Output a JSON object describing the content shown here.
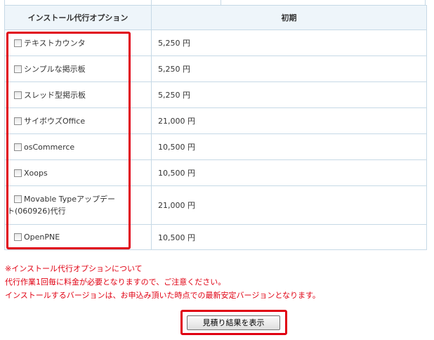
{
  "table": {
    "headers": {
      "option": "インストール代行オプション",
      "initial": "初期"
    },
    "rows": [
      {
        "label": "テキストカウンタ",
        "price": "5,250 円",
        "checked": false
      },
      {
        "label": "シンプルな掲示板",
        "price": "5,250 円",
        "checked": false
      },
      {
        "label": "スレッド型掲示板",
        "price": "5,250 円",
        "checked": false
      },
      {
        "label": "サイボウズOffice",
        "price": "21,000 円",
        "checked": false
      },
      {
        "label": "osCommerce",
        "price": "10,500 円",
        "checked": false
      },
      {
        "label": "Xoops",
        "price": "10,500 円",
        "checked": false
      },
      {
        "label": "Movable Typeアップデート(060926)代行",
        "price": "21,000 円",
        "checked": false
      },
      {
        "label": "OpenPNE",
        "price": "10,500 円",
        "checked": false
      }
    ]
  },
  "notes": [
    "※インストール代行オプションについて",
    "代行作業1回毎に料金が必要となりますので、ご注意ください。",
    "インストールするバージョンは、お申込み頂いた時点での最新安定バージョンとなります。"
  ],
  "button": {
    "label": "見積り結果を表示"
  },
  "colors": {
    "highlight": "#e00012",
    "border": "#c6d9e6",
    "header_bg": "#eef5fa",
    "note_text": "#e00012"
  }
}
